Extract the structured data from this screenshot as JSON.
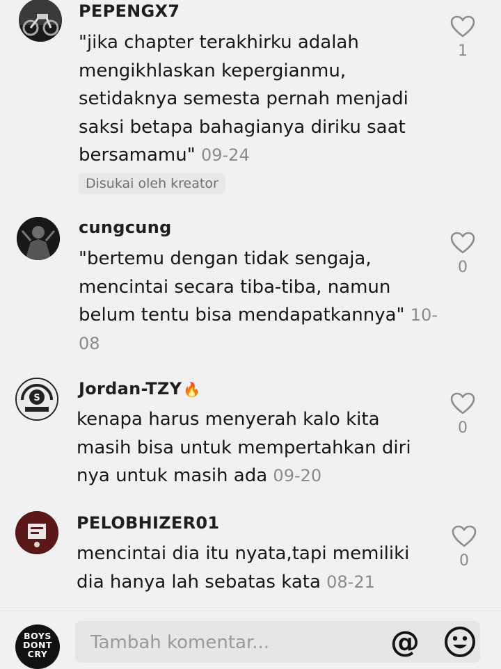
{
  "comments": [
    {
      "username": "PEPENGX7",
      "text": "\"jika chapter terakhirku adalah mengikhlaskan kepergianmu, setidaknya semesta pernah menjadi saksi betapa bahagianya diriku saat bersamamu\"",
      "date": "09-24",
      "liked_by": "Disukai oleh kreator",
      "likes": "1",
      "avatar_icon": "motorbike-avatar"
    },
    {
      "username": "cungcung",
      "text": "\"bertemu dengan tidak sengaja, mencintai secara tiba-tiba, namun belum tentu bisa mendapatkannya\"",
      "date": "10-08",
      "likes": "0",
      "avatar_icon": "dark-figure-avatar"
    },
    {
      "username": "Jordan-TZY",
      "username_badge": "🔥",
      "text": "kenapa harus menyerah kalo kita masih bisa untuk mempertahkan diri nya untuk masih ada",
      "date": "09-20",
      "likes": "0",
      "avatar_icon": "emblem-avatar"
    },
    {
      "username": "PELOBHIZER01",
      "text": "mencintai dia itu nyata,tapi memiliki dia hanya lah sebatas kata",
      "date": "08-21",
      "likes": "0",
      "avatar_icon": "red-logo-avatar"
    }
  ],
  "footer": {
    "my_avatar_text": [
      "BOYS",
      "DONT",
      "CRY"
    ],
    "placeholder": "Tambah komentar...",
    "mention_symbol": "@",
    "emoji_icon": "smiley-icon"
  },
  "colors": {
    "background": "#f1f1f1",
    "date_gray": "#8b8b8b",
    "liked_by_bg": "#e8e8e8"
  }
}
